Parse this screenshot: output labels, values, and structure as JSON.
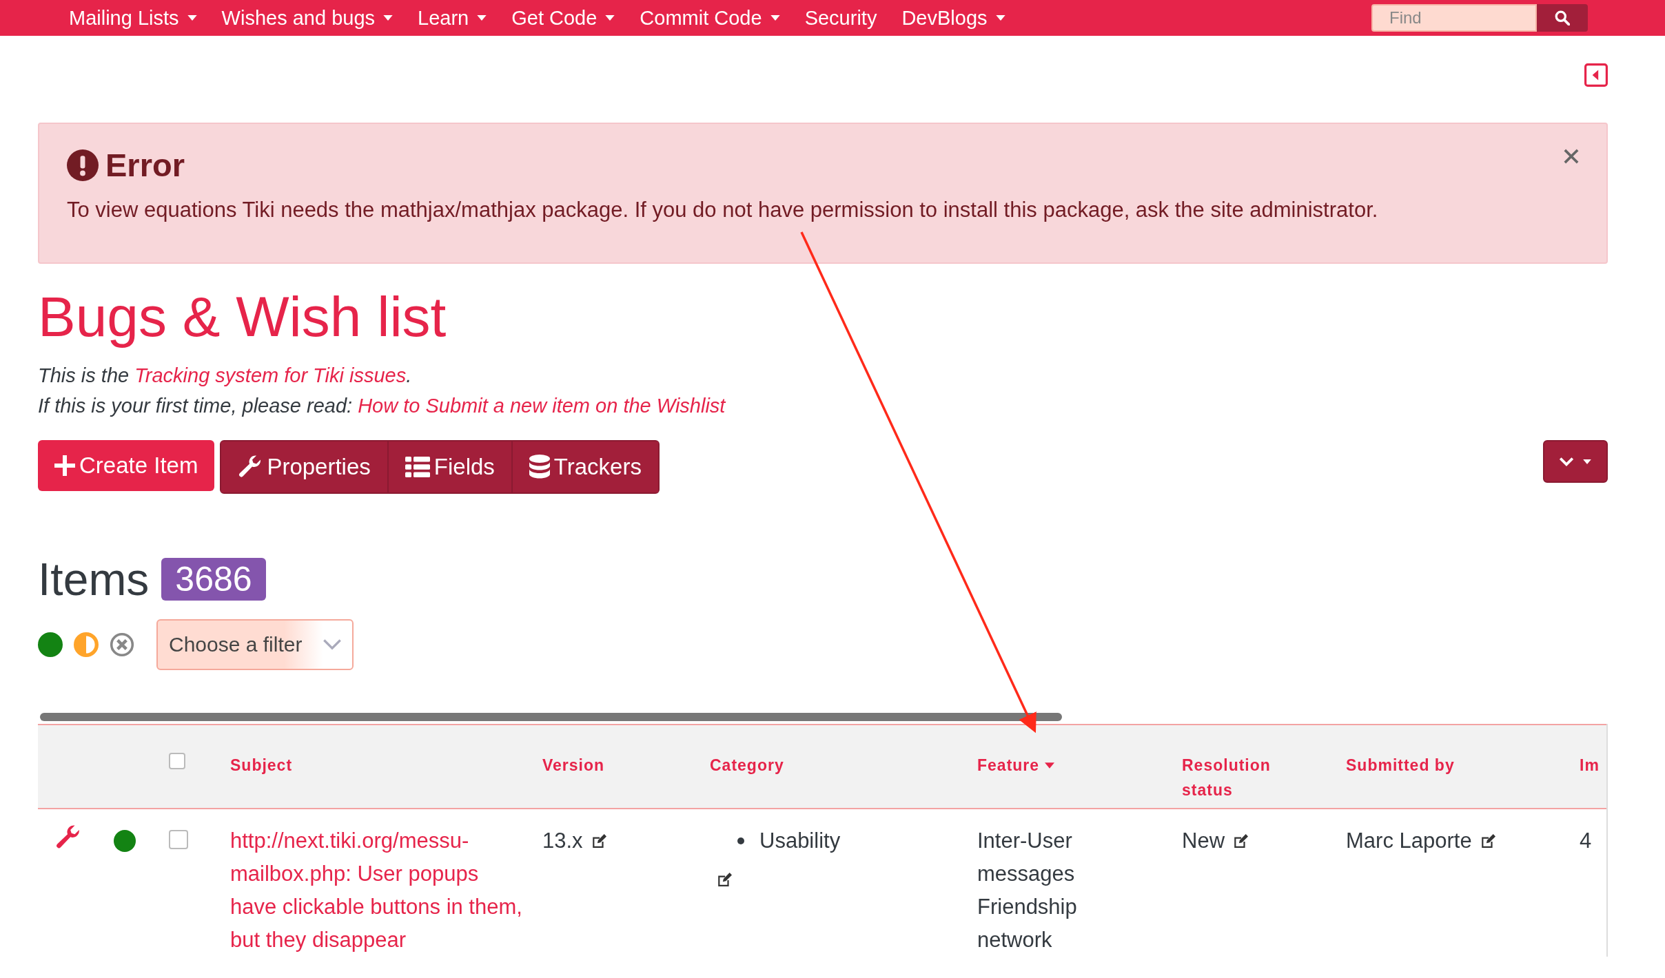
{
  "nav": {
    "items": [
      {
        "label": "Mailing Lists",
        "dropdown": true
      },
      {
        "label": "Wishes and bugs",
        "dropdown": true
      },
      {
        "label": "Learn",
        "dropdown": true
      },
      {
        "label": "Get Code",
        "dropdown": true
      },
      {
        "label": "Commit Code",
        "dropdown": true
      },
      {
        "label": "Security",
        "dropdown": false
      },
      {
        "label": "DevBlogs",
        "dropdown": true
      }
    ],
    "search": {
      "placeholder": "Find"
    }
  },
  "alert": {
    "title": "Error",
    "message": "To view equations Tiki needs the mathjax/mathjax package. If you do not have permission to install this package, ask the site administrator."
  },
  "title": "Bugs & Wish list",
  "description": [
    {
      "text": "This is the ",
      "link": "Tracking system for Tiki issues",
      "after": "."
    },
    {
      "text": "If this is your first time, please read: ",
      "link": "How to Submit a new item on the Wishlist"
    }
  ],
  "actions": [
    {
      "label": "Create Item",
      "kind": "create"
    },
    {
      "label": "Properties",
      "kind": "properties"
    },
    {
      "label": "Fields",
      "kind": "fields"
    },
    {
      "label": "Trackers",
      "kind": "trackers"
    }
  ],
  "items": {
    "heading": "Items",
    "count": "3686"
  },
  "status_filters": [
    {
      "kind": "open"
    },
    {
      "kind": "pending"
    },
    {
      "kind": "closed"
    }
  ],
  "filter": {
    "placeholder": "Choose a filter"
  },
  "table": {
    "select_all_checked": false,
    "columns": [
      {
        "label": "Subject",
        "sorted": false
      },
      {
        "label": "Version",
        "sorted": false
      },
      {
        "label": "Category",
        "sorted": false
      },
      {
        "label": "Feature",
        "sorted": true
      },
      {
        "label": "Resolution status",
        "sorted": false
      },
      {
        "label": "Submitted by",
        "sorted": false
      },
      {
        "label": "Im",
        "sorted": false
      }
    ],
    "rows": [
      {
        "color": "#138313",
        "checked": false,
        "subject": "http://next.tiki.org/messu-mailbox.php: User popups have clickable buttons in them, but they disappear",
        "version": "13.x",
        "category": [
          "Usability"
        ],
        "feature": [
          "Inter-User messages",
          "Friendship network"
        ],
        "resolution": "New",
        "submitted_by": "Marc Laporte",
        "column_7": "4"
      }
    ]
  }
}
